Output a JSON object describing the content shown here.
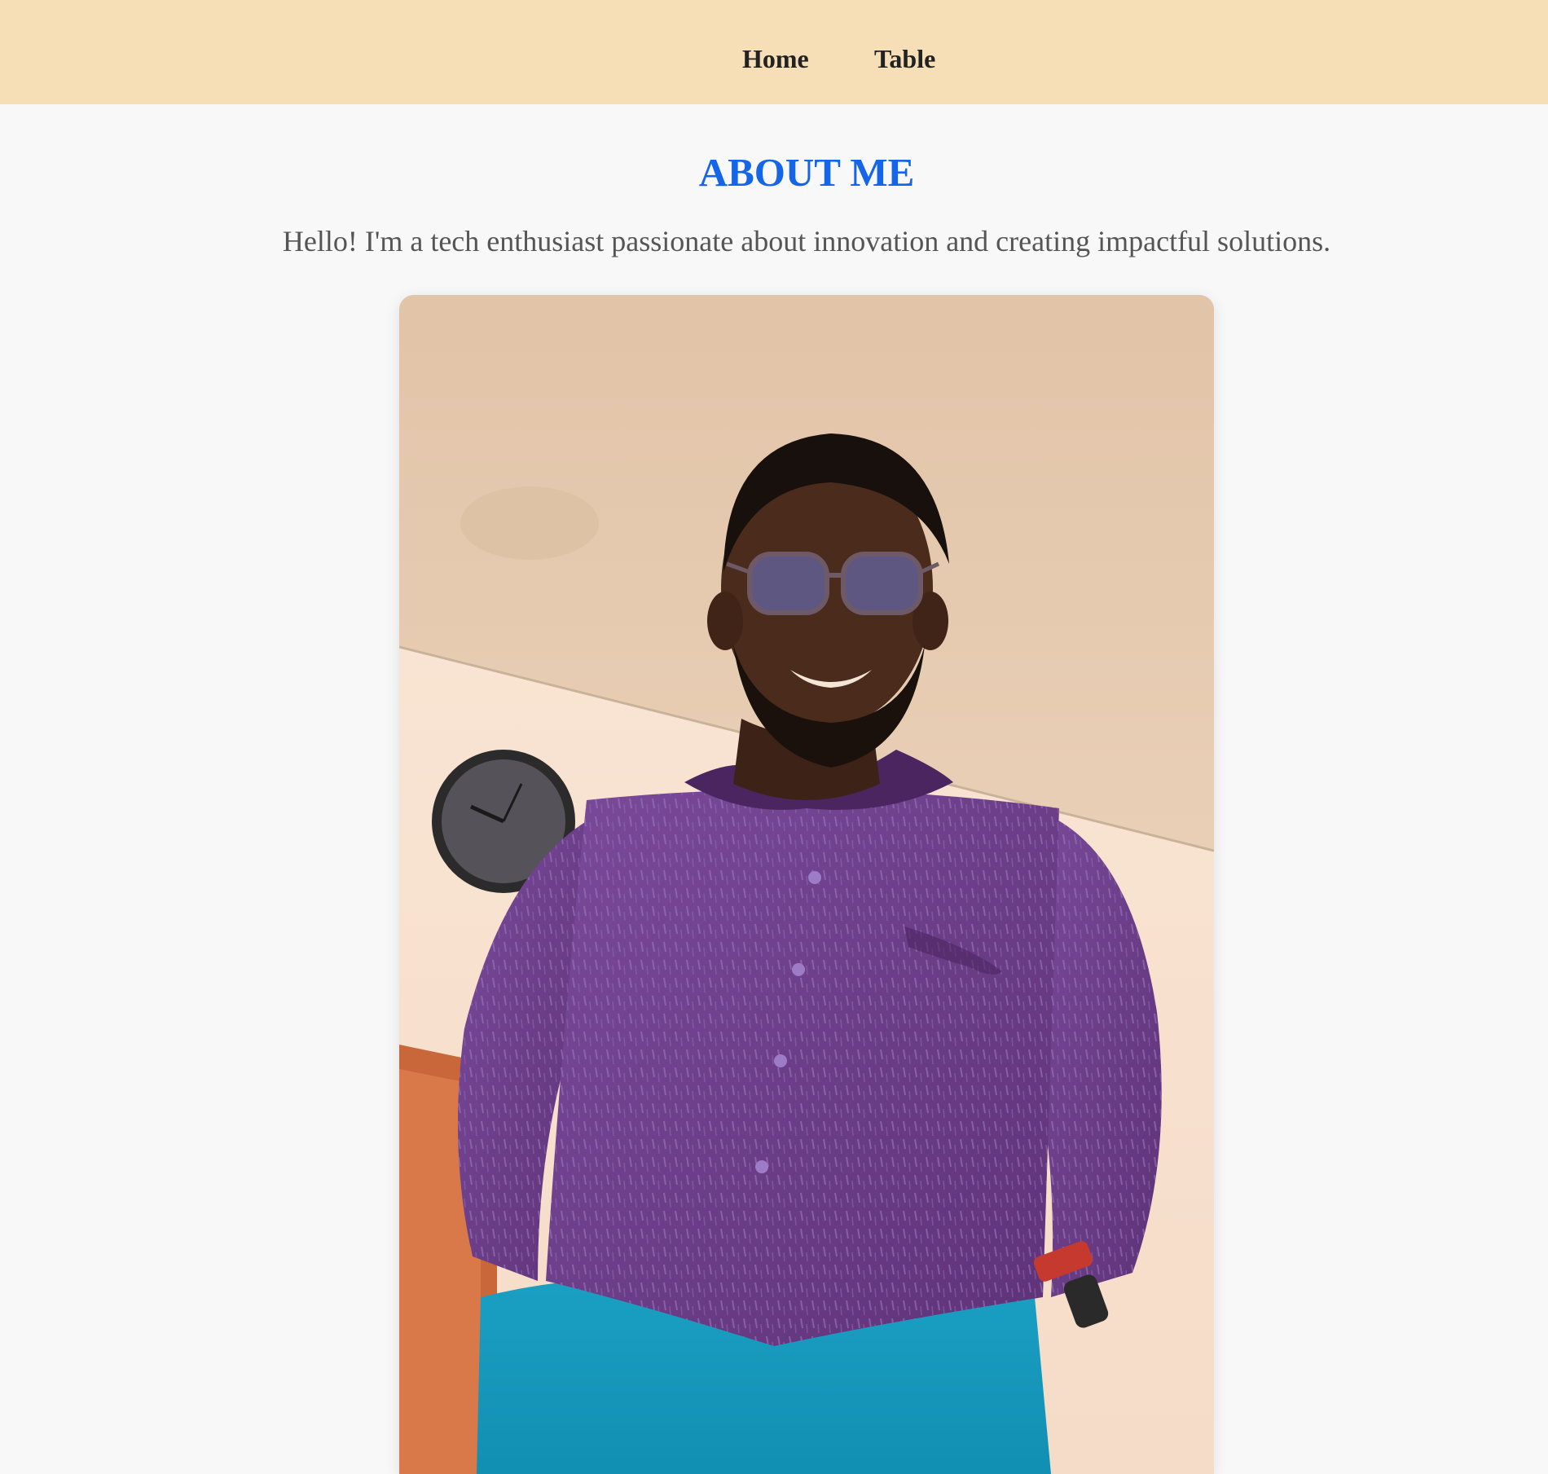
{
  "nav": {
    "items": [
      {
        "label": "Home"
      },
      {
        "label": "Table"
      }
    ]
  },
  "about": {
    "title": "ABOUT ME",
    "intro": "Hello! I'm a tech enthusiast passionate about innovation and creating impactful solutions."
  },
  "photo": {
    "subject": "portrait of a smiling man in glasses wearing a purple shirt and teal trousers, with a wall clock behind him"
  },
  "colors": {
    "navbar_bg": "#f6dfb7",
    "page_bg": "#f8f8f8",
    "title": "#1565e8",
    "intro_text": "#555555",
    "nav_text": "#222222"
  }
}
